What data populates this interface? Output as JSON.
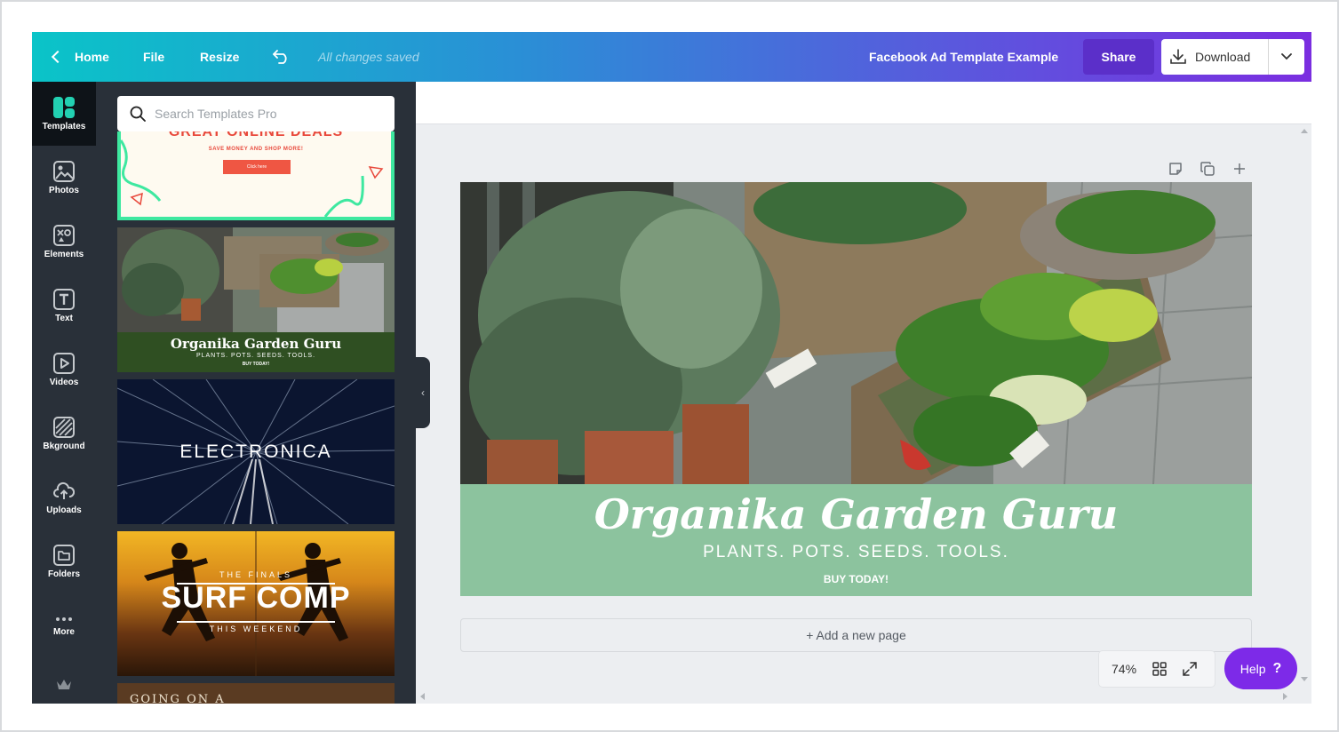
{
  "topbar": {
    "home_label": "Home",
    "file_label": "File",
    "resize_label": "Resize",
    "save_status": "All changes saved",
    "doc_title": "Facebook Ad Template Example",
    "share_label": "Share",
    "download_label": "Download",
    "undo_icon": "undo-icon",
    "gradient": [
      "#0ac4c8",
      "#2a8fd6",
      "#5a58dd",
      "#7a2ee0"
    ]
  },
  "rail": {
    "items": [
      {
        "label": "Templates",
        "icon": "templates-icon",
        "active": true
      },
      {
        "label": "Photos",
        "icon": "photos-icon"
      },
      {
        "label": "Elements",
        "icon": "elements-icon"
      },
      {
        "label": "Text",
        "icon": "text-icon"
      },
      {
        "label": "Videos",
        "icon": "videos-icon"
      },
      {
        "label": "Bkground",
        "icon": "background-icon"
      },
      {
        "label": "Uploads",
        "icon": "uploads-icon"
      },
      {
        "label": "Folders",
        "icon": "folders-icon"
      },
      {
        "label": "More",
        "icon": "more-icon"
      }
    ],
    "accent": "#22d1b2"
  },
  "panel": {
    "search_placeholder": "Search Templates Pro",
    "templates": [
      {
        "title": "GREAT ONLINE DEALS",
        "subtitle": "SAVE MONEY AND SHOP MORE!",
        "button": "Click here"
      },
      {
        "title": "Organika Garden Guru",
        "subtitle": "PLANTS. POTS. SEEDS. TOOLS.",
        "cta": "BUY TODAY!"
      },
      {
        "title": "ELECTRONICA"
      },
      {
        "kicker": "THE FINALS",
        "title": "SURF COMP",
        "subtitle": "THIS WEEKEND"
      },
      {
        "title": "GOING ON A"
      }
    ]
  },
  "design": {
    "title": "Organika Garden Guru",
    "subtitle": "PLANTS. POTS. SEEDS. TOOLS.",
    "cta": "BUY TODAY!",
    "band_color": "#8cc39e"
  },
  "editor": {
    "add_page_label": "+ Add a new page",
    "zoom": "74%",
    "help_label": "Help",
    "help_mark": "?"
  }
}
